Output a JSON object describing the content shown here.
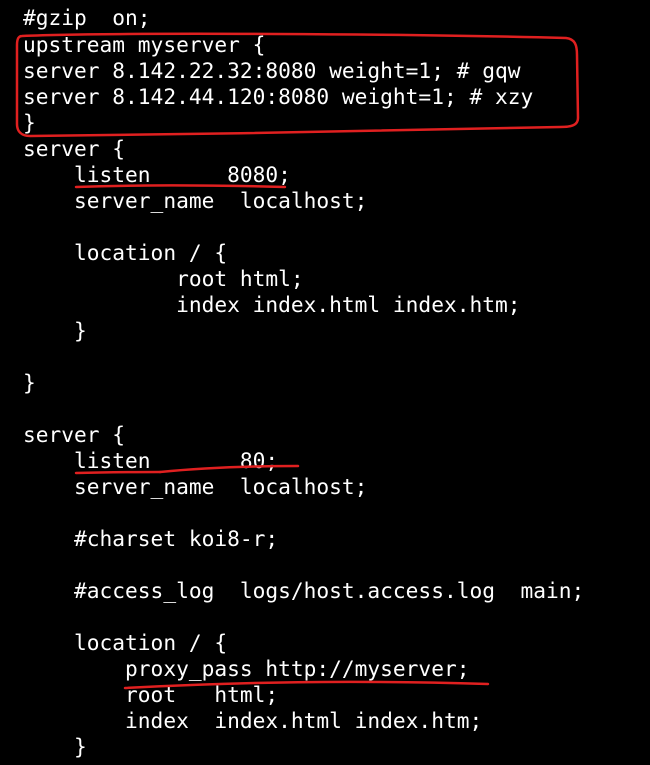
{
  "terminal": {
    "lines": [
      "#gzip  on;",
      "upstream myserver {",
      "server 8.142.22.32:8080 weight=1; # gqw",
      "server 8.142.44.120:8080 weight=1; # xzy",
      "}",
      "server {",
      "    listen      8080;",
      "    server_name  localhost;",
      "",
      "    location / {",
      "            root html;",
      "            index index.html index.htm;",
      "    }",
      "",
      "}",
      "",
      "server {",
      "    listen       80;",
      "    server_name  localhost;",
      "",
      "    #charset koi8-r;",
      "",
      "    #access_log  logs/host.access.log  main;",
      "",
      "    location / {",
      "        proxy_pass http://myserver;",
      "        root   html;",
      "        index  index.html index.htm;",
      "    }"
    ]
  },
  "annotation_color": "#e02020"
}
